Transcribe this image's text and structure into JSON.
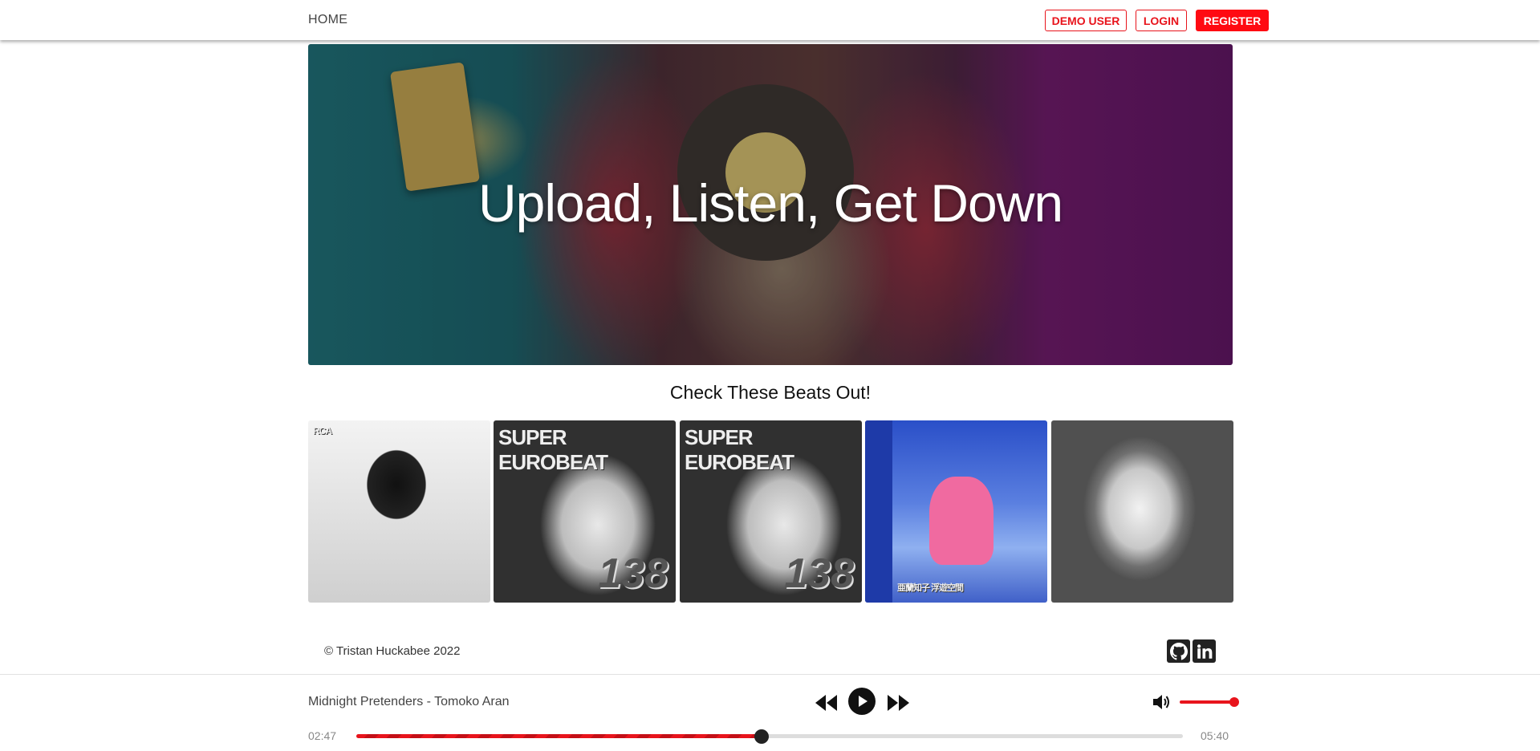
{
  "nav": {
    "home_label": "HOME",
    "demo_label": "DEMO USER",
    "login_label": "LOGIN",
    "register_label": "REGISTER",
    "accent": "#ff0a12"
  },
  "hero": {
    "title": "Upload, Listen, Get Down"
  },
  "section": {
    "title": "Check These Beats Out!",
    "covers": [
      {
        "text": "RCA",
        "num": ""
      },
      {
        "text": "SUPER EUROBEAT",
        "num": "138"
      },
      {
        "text": "SUPER EUROBEAT",
        "num": "138"
      },
      {
        "text": "亜蘭知子 浮遊空間",
        "num": ""
      },
      {
        "text": "",
        "num": ""
      }
    ]
  },
  "footer": {
    "copyright": "© Tristan Huckabee 2022",
    "icons": [
      "github-icon",
      "linkedin-icon"
    ]
  },
  "player": {
    "track": "Midnight Pretenders - Tomoko Aran",
    "elapsed": "02:47",
    "duration": "05:40",
    "progress_fraction": 0.49,
    "volume_fraction": 1.0
  }
}
